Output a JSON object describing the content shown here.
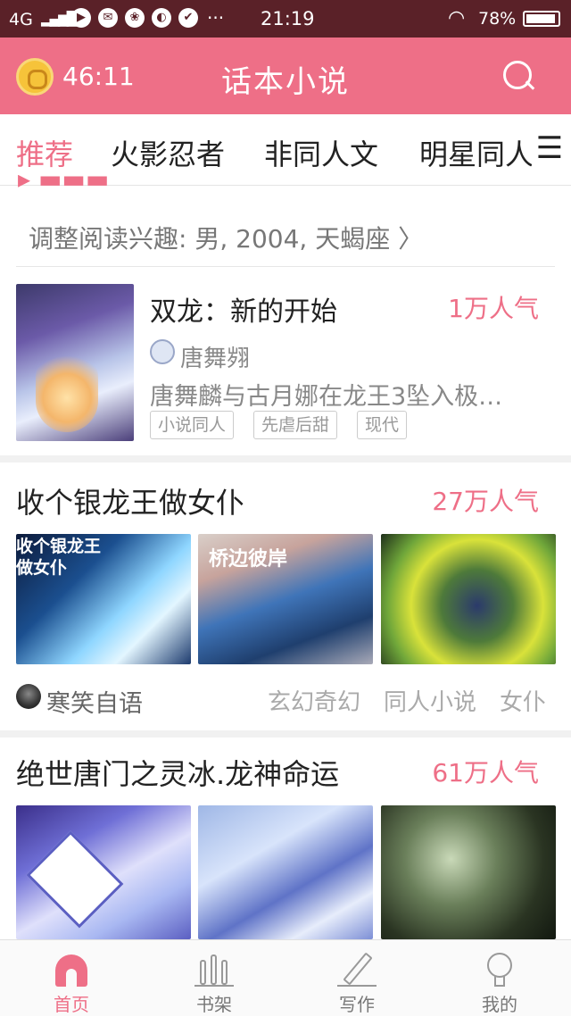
{
  "status_bar": {
    "signal": "4G",
    "time": "21:19",
    "battery": "78%"
  },
  "header": {
    "timer": "46:11",
    "title": "话本小说"
  },
  "tabs": [
    "推荐",
    "火影忍者",
    "非同人文",
    "明星同人"
  ],
  "interest": "调整阅读兴趣: 男, 2004, 天蝎座 〉",
  "book1": {
    "title": "双龙：新的开始",
    "popularity": "1万人气",
    "author": "唐舞翙",
    "description": "唐舞麟与古月娜在龙王3坠入极…",
    "tags": [
      "小说同人",
      "先虐后甜",
      "现代"
    ]
  },
  "book2": {
    "title": "收个银龙王做女仆",
    "popularity": "27万人气",
    "cover_texts": [
      "收个银龙王做女仆",
      "桥边彼岸"
    ],
    "author": "寒笑自语",
    "genres": [
      "玄幻奇幻",
      "同人小说",
      "女仆"
    ]
  },
  "book3": {
    "title": "绝世唐门之灵冰.龙神命运",
    "popularity": "61万人气"
  },
  "nav": [
    "首页",
    "书架",
    "写作",
    "我的"
  ],
  "colors": {
    "accent": "#ee6f87",
    "status_bar": "#5a2128"
  }
}
